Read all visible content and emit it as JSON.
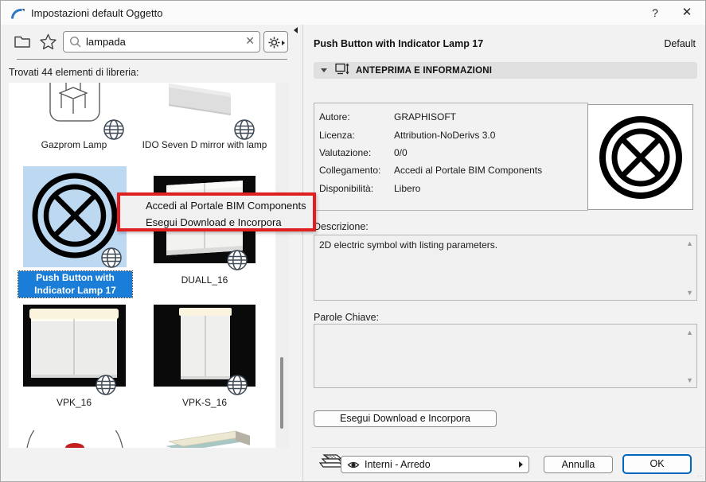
{
  "window": {
    "title": "Impostazioni default Oggetto",
    "help_label": "?",
    "close_label": "✕"
  },
  "toolbar": {
    "search_value": "lampada",
    "clear_label": "✕",
    "results_text": "Trovati 44 elementi di libreria:"
  },
  "library": {
    "items": [
      {
        "label": "Gazprom Lamp",
        "selected": false
      },
      {
        "label": "IDO Seven D mirror with lamp",
        "selected": false
      },
      {
        "label": "Push Button with Indicator Lamp 17",
        "selected": true
      },
      {
        "label": "DUALL_16",
        "selected": false
      },
      {
        "label": "VPK_16",
        "selected": false
      },
      {
        "label": "VPK-S_16",
        "selected": false
      }
    ]
  },
  "context_menu": {
    "annotation_color": "#e02020",
    "items": [
      {
        "label": "Accedi al Portale BIM Components"
      },
      {
        "label": "Esegui Download e Incorpora"
      }
    ]
  },
  "details": {
    "title": "Push Button with Indicator Lamp 17",
    "state_label": "Default",
    "section_title": "ANTEPRIMA E INFORMAZIONI",
    "fields": [
      {
        "label": "Autore:",
        "value": "GRAPHISOFT"
      },
      {
        "label": "Licenza:",
        "value": "Attribution-NoDerivs 3.0"
      },
      {
        "label": "Valutazione:",
        "value": "0/0"
      },
      {
        "label": "Collegamento:",
        "value": "Accedi al Portale BIM Components"
      },
      {
        "label": "Disponibilità:",
        "value": "Libero"
      }
    ],
    "description_label": "Descrizione:",
    "description_text": "2D electric symbol with listing parameters.",
    "keywords_label": "Parole Chiave:",
    "keywords_text": "",
    "download_button_label": "Esegui Download e Incorpora"
  },
  "footer": {
    "layer_combo_value": "Interni - Arredo",
    "cancel_label": "Annulla",
    "ok_label": "OK"
  },
  "icons": {
    "scroll_up": "▲",
    "scroll_down": "▼",
    "resize_grip": "∙∙"
  },
  "colors": {
    "selection_blue": "#1a7dd7",
    "selection_tile": "#bdd9f2",
    "annotation_red": "#e02020",
    "ok_border_blue": "#0067c0"
  }
}
